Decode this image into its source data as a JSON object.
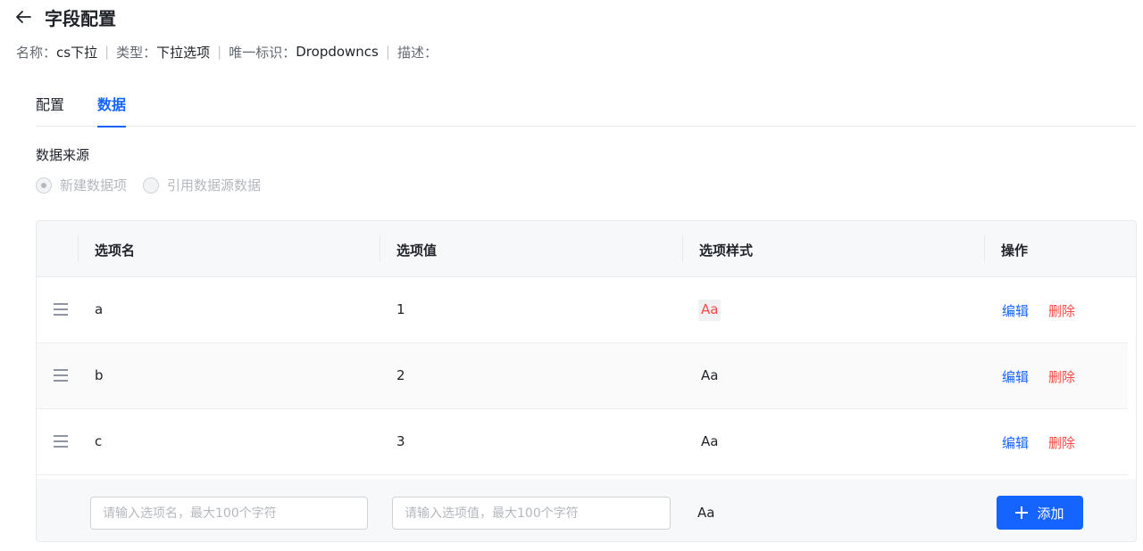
{
  "header": {
    "title": "字段配置"
  },
  "meta": {
    "name_key": "名称：",
    "name_value": "cs下拉",
    "type_key": "类型：",
    "type_value": "下拉选项",
    "id_key": "唯一标识：",
    "id_value": "Dropdowncs",
    "desc_key": "描述：",
    "separator": "|"
  },
  "tabs": [
    {
      "label": "配置",
      "active": false
    },
    {
      "label": "数据",
      "active": true
    }
  ],
  "data_source": {
    "label": "数据来源",
    "options": [
      {
        "label": "新建数据项",
        "checked": true
      },
      {
        "label": "引用数据源数据",
        "checked": false
      }
    ]
  },
  "table": {
    "columns": [
      "选项名",
      "选项值",
      "选项样式",
      "操作"
    ],
    "rows": [
      {
        "name": "a",
        "value": "1",
        "style": "Aa",
        "style_color": "#f54a45",
        "edit": "编辑",
        "delete": "删除"
      },
      {
        "name": "b",
        "value": "2",
        "style": "Aa",
        "style_color": "#1f2329",
        "edit": "编辑",
        "delete": "删除"
      },
      {
        "name": "c",
        "value": "3",
        "style": "Aa",
        "style_color": "#1f2329",
        "edit": "编辑",
        "delete": "删除"
      }
    ],
    "add_row": {
      "name_placeholder": "请输入选项名，最大100个字符",
      "value_placeholder": "请输入选项值，最大100个字符",
      "style": "Aa",
      "add_label": "添加"
    }
  },
  "colors": {
    "primary": "#1664ff",
    "danger": "#f54a45"
  }
}
